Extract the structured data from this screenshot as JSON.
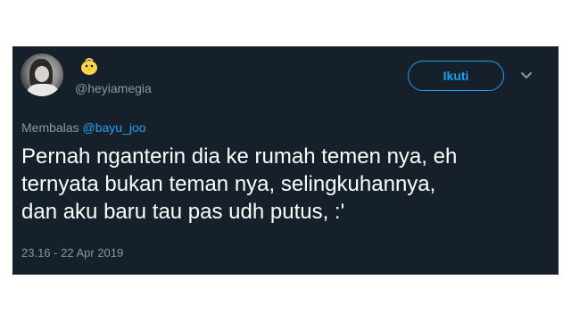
{
  "tweet": {
    "user": {
      "handle": "@heyiamegia",
      "display_icon": "chick-emoji-icon"
    },
    "follow_label": "Ikuti",
    "reply": {
      "prefix": "Membalas",
      "mention": "@bayu_joo"
    },
    "text_lines": [
      "Pernah nganterin dia ke rumah temen nya, eh",
      "ternyata bukan teman nya, selingkuhannya,",
      "dan aku baru tau pas udh putus, :'"
    ],
    "timestamp": "23.16 - 22 Apr 2019"
  },
  "colors": {
    "background": "#15202b",
    "accent": "#1da1f2",
    "muted": "#8899a6",
    "text": "#ffffff"
  }
}
